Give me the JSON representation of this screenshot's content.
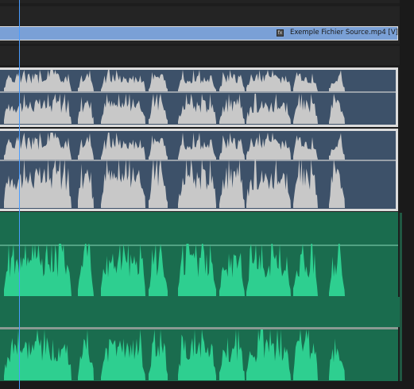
{
  "timeline": {
    "video_track": {
      "clip_label": "Exemple Fichier Source.mp4 [V]",
      "fx_badge": "fx",
      "clip_color": "#7aa0d6"
    },
    "audio_tracks": [
      {
        "clip_color": "#3d5169",
        "waveform_color": "#c8c8c8",
        "selected": true
      },
      {
        "clip_color": "#3d5169",
        "waveform_color": "#c8c8c8",
        "selected": true
      },
      {
        "clip_color": "#1a6c4e",
        "waveform_color": "#2ecf90",
        "selected": false
      },
      {
        "clip_color": "#1a6c4e",
        "waveform_color": "#2ecf90",
        "selected": false
      }
    ],
    "playhead_color": "#4a9cff"
  },
  "colors": {
    "background": "#1d1d1d",
    "selected_border": "#dcdcdc"
  }
}
